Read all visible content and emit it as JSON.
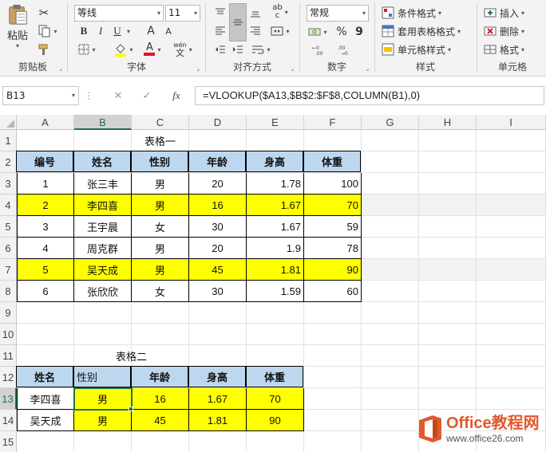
{
  "ribbon": {
    "clipboard": {
      "label": "剪贴板",
      "paste_label": "粘贴",
      "cut_icon": "scissors-icon",
      "copy_icon": "copy-icon",
      "format_painter_icon": "brush-icon"
    },
    "font": {
      "label": "字体",
      "font_name": "等线",
      "font_size": "11",
      "grow_label": "A",
      "shrink_label": "A",
      "bold": "B",
      "italic": "I",
      "underline": "U",
      "font_color_label": "A",
      "phonetic_label": "wén",
      "phonetic_char": "文"
    },
    "alignment": {
      "label": "对齐方式",
      "wrap_label": "ab",
      "wrap_sub": "c"
    },
    "number": {
      "label": "数字",
      "format": "常规",
      "percent": "%",
      "comma": "9"
    },
    "styles": {
      "label": "样式",
      "conditional": "条件格式",
      "table": "套用表格格式",
      "cell_styles": "单元格样式"
    },
    "cells": {
      "label": "单元格",
      "insert": "插入",
      "delete": "删除",
      "format": "格式"
    },
    "accent_red": "#e81123",
    "highlight_yellow": "#ffff00"
  },
  "formula_bar": {
    "name_box": "B13",
    "cancel": "✕",
    "enter": "✓",
    "fx": "fx",
    "formula": "=VLOOKUP($A13,$B$2:$F$8,COLUMN(B1),0)"
  },
  "sheet": {
    "columns": [
      "A",
      "B",
      "C",
      "D",
      "E",
      "F",
      "G",
      "H",
      "I"
    ],
    "rows": [
      "1",
      "2",
      "3",
      "4",
      "5",
      "6",
      "7",
      "8",
      "9",
      "10",
      "11",
      "12",
      "13",
      "14",
      "15"
    ],
    "table1": {
      "title": "表格一",
      "headers": [
        "编号",
        "姓名",
        "性别",
        "年龄",
        "身高",
        "体重"
      ],
      "rows": [
        [
          "1",
          "张三丰",
          "男",
          "20",
          "1.78",
          "100"
        ],
        [
          "2",
          "李四喜",
          "男",
          "16",
          "1.67",
          "70"
        ],
        [
          "3",
          "王宇晨",
          "女",
          "30",
          "1.67",
          "59"
        ],
        [
          "4",
          "周克群",
          "男",
          "20",
          "1.9",
          "78"
        ],
        [
          "5",
          "吴天成",
          "男",
          "45",
          "1.81",
          "90"
        ],
        [
          "6",
          "张欣欣",
          "女",
          "30",
          "1.59",
          "60"
        ]
      ]
    },
    "table2": {
      "title": "表格二",
      "headers": [
        "姓名",
        "性别",
        "年龄",
        "身高",
        "体重"
      ],
      "rows": [
        [
          "李四喜",
          "男",
          "16",
          "1.67",
          "70"
        ],
        [
          "吴天成",
          "男",
          "45",
          "1.81",
          "90"
        ]
      ]
    },
    "header_fill": "#bdd7ee",
    "highlight_fill": "#ffff00",
    "selection_color": "#217346"
  },
  "watermark": {
    "line1": "Office教程网",
    "line2": "www.office26.com",
    "logo_color": "#e2592d"
  }
}
